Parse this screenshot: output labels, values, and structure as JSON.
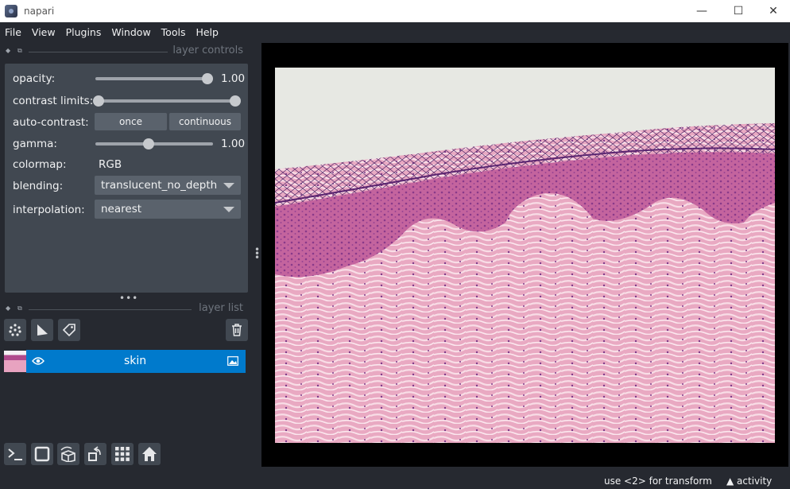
{
  "window": {
    "title": "napari",
    "minimize": "—",
    "maximize": "☐",
    "close": "✕"
  },
  "menu": [
    "File",
    "View",
    "Plugins",
    "Window",
    "Tools",
    "Help"
  ],
  "layer_controls": {
    "header": "layer controls",
    "opacity": {
      "label": "opacity:",
      "value": "1.00",
      "level": 1.0
    },
    "contrast_limits": {
      "label": "contrast limits:",
      "low": 0.0,
      "high": 1.0
    },
    "auto_contrast": {
      "label": "auto-contrast:",
      "once": "once",
      "continuous": "continuous"
    },
    "gamma": {
      "label": "gamma:",
      "value": "1.00",
      "level": 0.5
    },
    "colormap": {
      "label": "colormap:",
      "value": "RGB"
    },
    "blending": {
      "label": "blending:",
      "value": "translucent_no_depth"
    },
    "interpolation": {
      "label": "interpolation:",
      "value": "nearest"
    }
  },
  "layer_list": {
    "header": "layer list",
    "tools": [
      "points-icon",
      "shapes-icon",
      "labels-icon"
    ],
    "delete": "trash-icon",
    "layers": [
      {
        "name": "skin",
        "visible": true,
        "type_icon": "image-icon"
      }
    ]
  },
  "viewer_buttons": [
    "console-icon",
    "ndisplay-icon",
    "roll-icon",
    "transpose-icon",
    "grid-icon",
    "home-icon"
  ],
  "status": {
    "hint": "use <2> for transform",
    "activity": "activity"
  },
  "colors": {
    "bg": "#262930",
    "panel": "#414851",
    "accent": "#007acc"
  }
}
